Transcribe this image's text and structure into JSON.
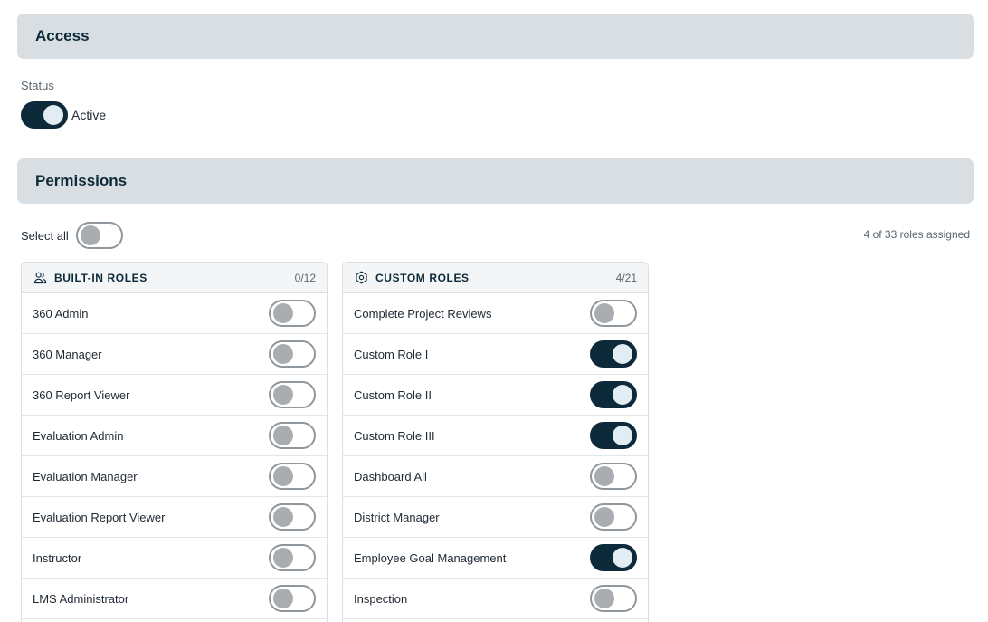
{
  "access": {
    "title": "Access"
  },
  "status": {
    "label": "Status",
    "value": "Active",
    "enabled": true
  },
  "permissions": {
    "title": "Permissions"
  },
  "select_all": {
    "label": "Select all",
    "enabled": false
  },
  "summary": "4 of 33 roles assigned",
  "builtin_roles": {
    "title": "BUILT-IN ROLES",
    "count": "0/12",
    "icon": "users-icon",
    "items": [
      {
        "name": "360 Admin",
        "enabled": false
      },
      {
        "name": "360 Manager",
        "enabled": false
      },
      {
        "name": "360 Report Viewer",
        "enabled": false
      },
      {
        "name": "Evaluation Admin",
        "enabled": false
      },
      {
        "name": "Evaluation Manager",
        "enabled": false
      },
      {
        "name": "Evaluation Report Viewer",
        "enabled": false
      },
      {
        "name": "Instructor",
        "enabled": false
      },
      {
        "name": "LMS Administrator",
        "enabled": false
      }
    ]
  },
  "custom_roles": {
    "title": "CUSTOM ROLES",
    "count": "4/21",
    "icon": "gear-icon",
    "items": [
      {
        "name": "Complete Project Reviews",
        "enabled": false
      },
      {
        "name": "Custom Role I",
        "enabled": true
      },
      {
        "name": "Custom Role II",
        "enabled": true
      },
      {
        "name": "Custom Role III",
        "enabled": true
      },
      {
        "name": "Dashboard All",
        "enabled": false
      },
      {
        "name": "District Manager",
        "enabled": false
      },
      {
        "name": "Employee Goal Management",
        "enabled": true
      },
      {
        "name": "Inspection",
        "enabled": false
      }
    ]
  },
  "colors": {
    "accent": "#0d2a3a",
    "header_bg": "#d9dee2",
    "toggle_off_knob": "#a9adb1"
  }
}
